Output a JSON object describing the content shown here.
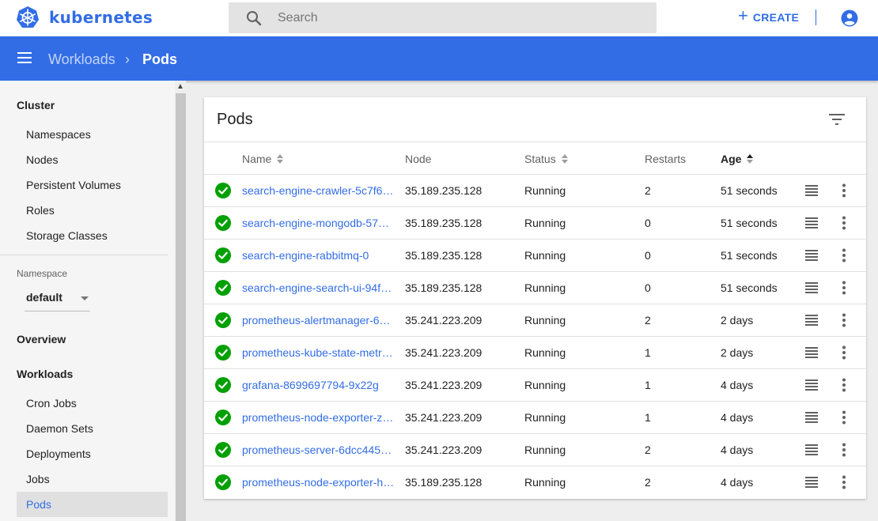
{
  "app": {
    "brand": "kubernetes",
    "brand_color": "#326de6"
  },
  "topbar": {
    "search_placeholder": "Search",
    "create_label": "CREATE",
    "create_plus": "+"
  },
  "breadcrumb": {
    "parent": "Workloads",
    "separator": "›",
    "current": "Pods"
  },
  "sidebar": {
    "cluster_heading": "Cluster",
    "cluster_items": [
      {
        "label": "Namespaces"
      },
      {
        "label": "Nodes"
      },
      {
        "label": "Persistent Volumes"
      },
      {
        "label": "Roles"
      },
      {
        "label": "Storage Classes"
      }
    ],
    "namespace_label": "Namespace",
    "namespace_value": "default",
    "overview_heading": "Overview",
    "workloads_heading": "Workloads",
    "workload_items": [
      {
        "label": "Cron Jobs"
      },
      {
        "label": "Daemon Sets"
      },
      {
        "label": "Deployments"
      },
      {
        "label": "Jobs"
      },
      {
        "label": "Pods",
        "active": true
      }
    ]
  },
  "card": {
    "title": "Pods",
    "columns": {
      "name": "Name",
      "node": "Node",
      "status": "Status",
      "restarts": "Restarts",
      "age": "Age"
    },
    "rows": [
      {
        "name": "search-engine-crawler-5c7f6…",
        "node": "35.189.235.128",
        "status": "Running",
        "restarts": "2",
        "age": "51 seconds"
      },
      {
        "name": "search-engine-mongodb-57…",
        "node": "35.189.235.128",
        "status": "Running",
        "restarts": "0",
        "age": "51 seconds"
      },
      {
        "name": "search-engine-rabbitmq-0",
        "node": "35.189.235.128",
        "status": "Running",
        "restarts": "0",
        "age": "51 seconds"
      },
      {
        "name": "search-engine-search-ui-94f…",
        "node": "35.189.235.128",
        "status": "Running",
        "restarts": "0",
        "age": "51 seconds"
      },
      {
        "name": "prometheus-alertmanager-6…",
        "node": "35.241.223.209",
        "status": "Running",
        "restarts": "2",
        "age": "2 days"
      },
      {
        "name": "prometheus-kube-state-metr…",
        "node": "35.241.223.209",
        "status": "Running",
        "restarts": "1",
        "age": "2 days"
      },
      {
        "name": "grafana-8699697794-9x22g",
        "node": "35.241.223.209",
        "status": "Running",
        "restarts": "1",
        "age": "4 days"
      },
      {
        "name": "prometheus-node-exporter-z…",
        "node": "35.241.223.209",
        "status": "Running",
        "restarts": "1",
        "age": "4 days"
      },
      {
        "name": "prometheus-server-6dcc445…",
        "node": "35.241.223.209",
        "status": "Running",
        "restarts": "2",
        "age": "4 days"
      },
      {
        "name": "prometheus-node-exporter-h…",
        "node": "35.189.235.128",
        "status": "Running",
        "restarts": "2",
        "age": "4 days"
      }
    ]
  },
  "colors": {
    "accent": "#326de6",
    "success": "#00a000"
  },
  "icons": [
    "kubernetes-logo-icon",
    "search-icon",
    "plus-icon",
    "account-circle-icon",
    "menu-icon",
    "filter-icon",
    "sort-icon",
    "check-circle-icon",
    "logs-icon",
    "more-vert-icon"
  ]
}
